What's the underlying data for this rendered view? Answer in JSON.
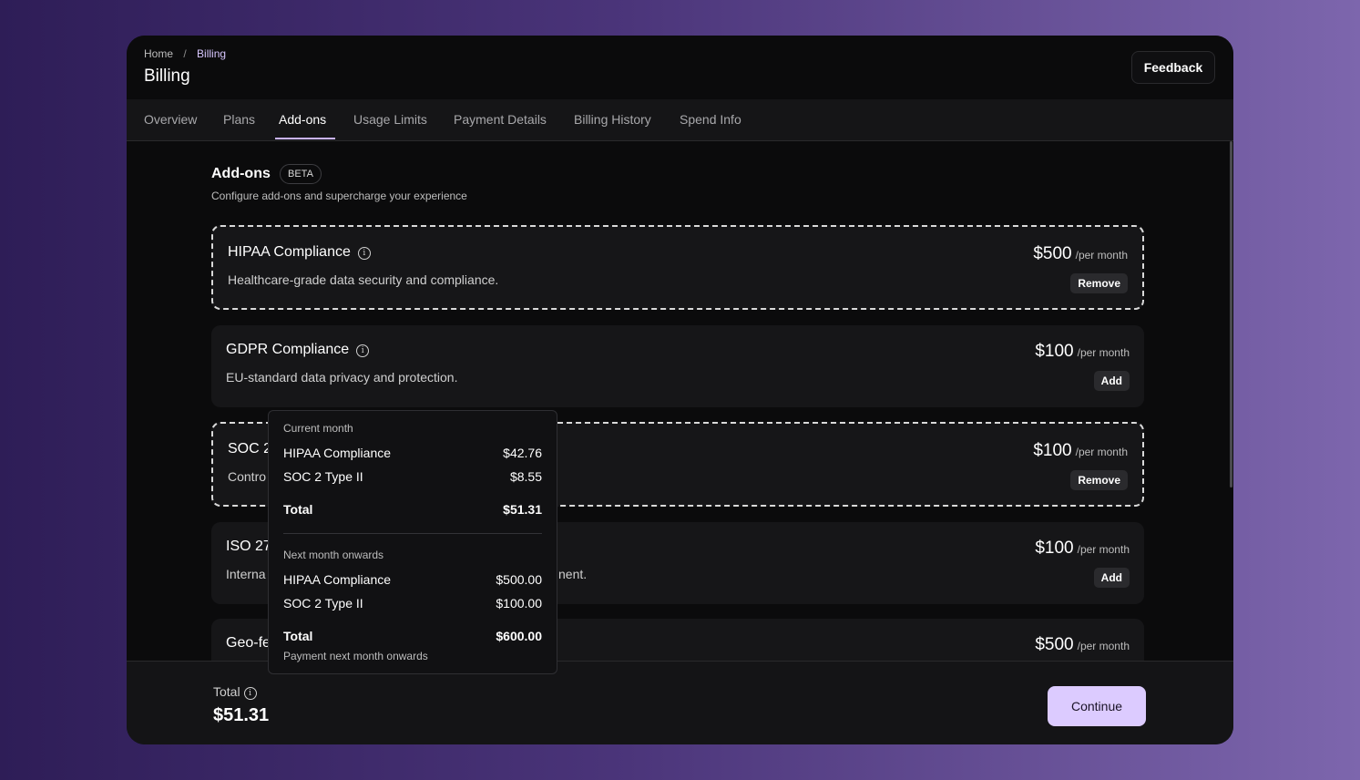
{
  "breadcrumb": {
    "home": "Home",
    "separator": "/",
    "current": "Billing"
  },
  "page_title": "Billing",
  "feedback_label": "Feedback",
  "tabs": [
    {
      "label": "Overview"
    },
    {
      "label": "Plans"
    },
    {
      "label": "Add-ons"
    },
    {
      "label": "Usage Limits"
    },
    {
      "label": "Payment Details"
    },
    {
      "label": "Billing History"
    },
    {
      "label": "Spend Info"
    }
  ],
  "active_tab": "Add-ons",
  "section": {
    "title": "Add-ons",
    "badge": "BETA",
    "subtitle": "Configure add-ons and supercharge your experience"
  },
  "addons": [
    {
      "name": "HIPAA Compliance",
      "description": "Healthcare-grade data security and compliance.",
      "price": "$500",
      "period": "/per month",
      "action": "Remove",
      "selected": true
    },
    {
      "name": "GDPR Compliance",
      "description": "EU-standard data privacy and protection.",
      "price": "$100",
      "period": "/per month",
      "action": "Add",
      "selected": false
    },
    {
      "name": "SOC 2",
      "description": "Contro",
      "price": "$100",
      "period": "/per month",
      "action": "Remove",
      "selected": true
    },
    {
      "name": "ISO 27",
      "description": "Interna",
      "description_tail": "nent.",
      "price": "$100",
      "period": "/per month",
      "action": "Add",
      "selected": false
    },
    {
      "name": "Geo-fe",
      "price": "$500",
      "period": "/per month"
    }
  ],
  "info_icon": "info-icon",
  "popover": {
    "current_label": "Current month",
    "current_items": [
      {
        "name": "HIPAA Compliance",
        "amount": "$42.76"
      },
      {
        "name": "SOC 2 Type II",
        "amount": "$8.55"
      }
    ],
    "current_total_label": "Total",
    "current_total": "$51.31",
    "next_label": "Next month onwards",
    "next_items": [
      {
        "name": "HIPAA Compliance",
        "amount": "$500.00"
      },
      {
        "name": "SOC 2 Type II",
        "amount": "$100.00"
      }
    ],
    "next_total_label": "Total",
    "next_total": "$600.00",
    "next_note": "Payment next month onwards"
  },
  "footer": {
    "total_label": "Total",
    "total_value": "$51.31",
    "continue_label": "Continue"
  },
  "colors": {
    "accent": "#dccbff",
    "tab_underline": "#c9b3ff",
    "background_start": "#2e1d57",
    "background_end": "#7d66ad"
  }
}
